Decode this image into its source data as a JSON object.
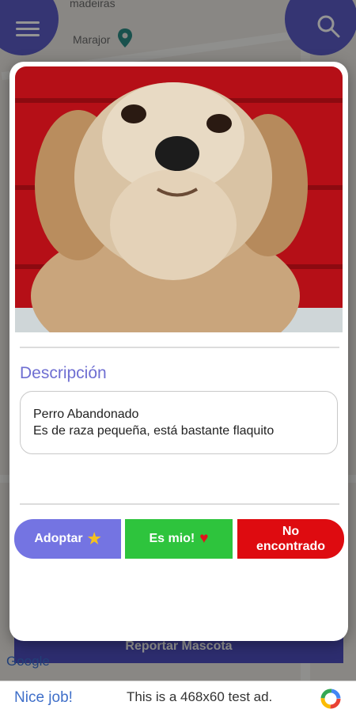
{
  "map": {
    "label_top": "madeiras",
    "label_place": "Marajor",
    "icons": [
      "menu-icon",
      "search-icon",
      "location-pin-icon"
    ]
  },
  "background": {
    "report_button": "Reportar Mascota",
    "google_text": "Google"
  },
  "dialog": {
    "image_alt": "Perro pequeño de pelo crema frente a una pared roja",
    "section_title": "Descripción",
    "description_lines": [
      "Perro Abandonado",
      "Es de raza pequeña, está bastante flaquito"
    ],
    "buttons": {
      "adopt": {
        "label": "Adoptar",
        "icon": "star-icon"
      },
      "mine": {
        "label": "Es mio!",
        "icon": "heart-icon"
      },
      "not_found": {
        "line1": "No",
        "line2": "encontrado"
      }
    }
  },
  "ad": {
    "nice": "Nice job!",
    "text": "This is a 468x60 test ad."
  },
  "colors": {
    "accent": "#5c5cc7",
    "adopt": "#7474e2",
    "mine": "#2ec43d",
    "not_found": "#de0b10"
  }
}
